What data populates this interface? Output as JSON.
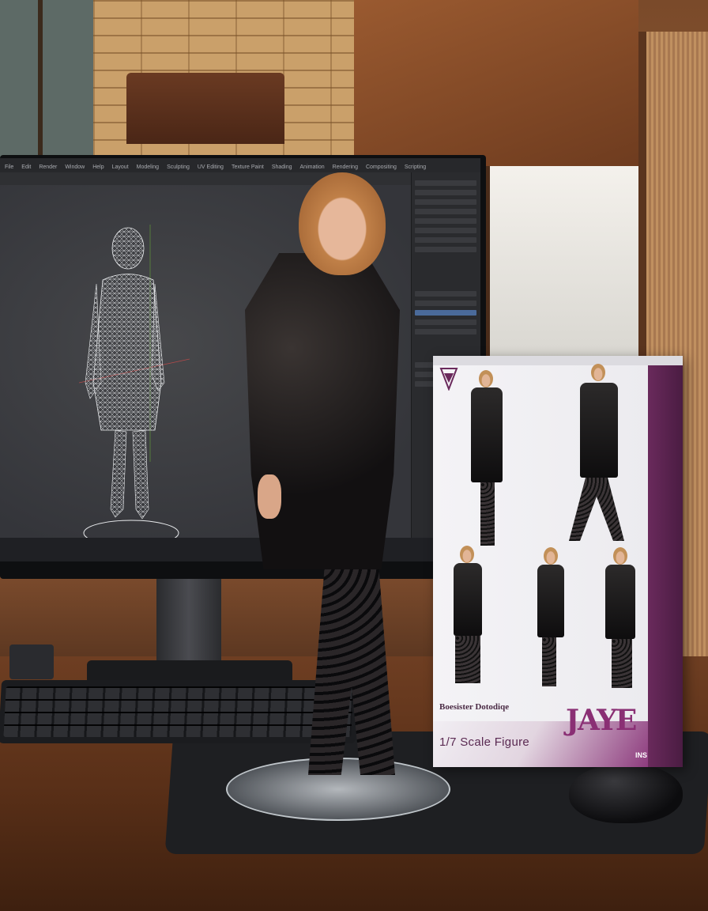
{
  "box": {
    "brand": "Boesister Dotodiqe",
    "scale_label": "1/7 Scale Figure",
    "name_logo": "JAYE",
    "corner_code": "INS"
  },
  "screen": {
    "menu_items": [
      "File",
      "Edit",
      "Render",
      "Window",
      "Help",
      "Layout",
      "Modeling",
      "Sculpting",
      "UV Editing",
      "Texture Paint",
      "Shading",
      "Animation",
      "Rendering",
      "Compositing",
      "Scripting"
    ]
  },
  "colors": {
    "box_accent": "#8a2f74",
    "desk": "#5a3018",
    "viewport": "#3c3d40"
  }
}
